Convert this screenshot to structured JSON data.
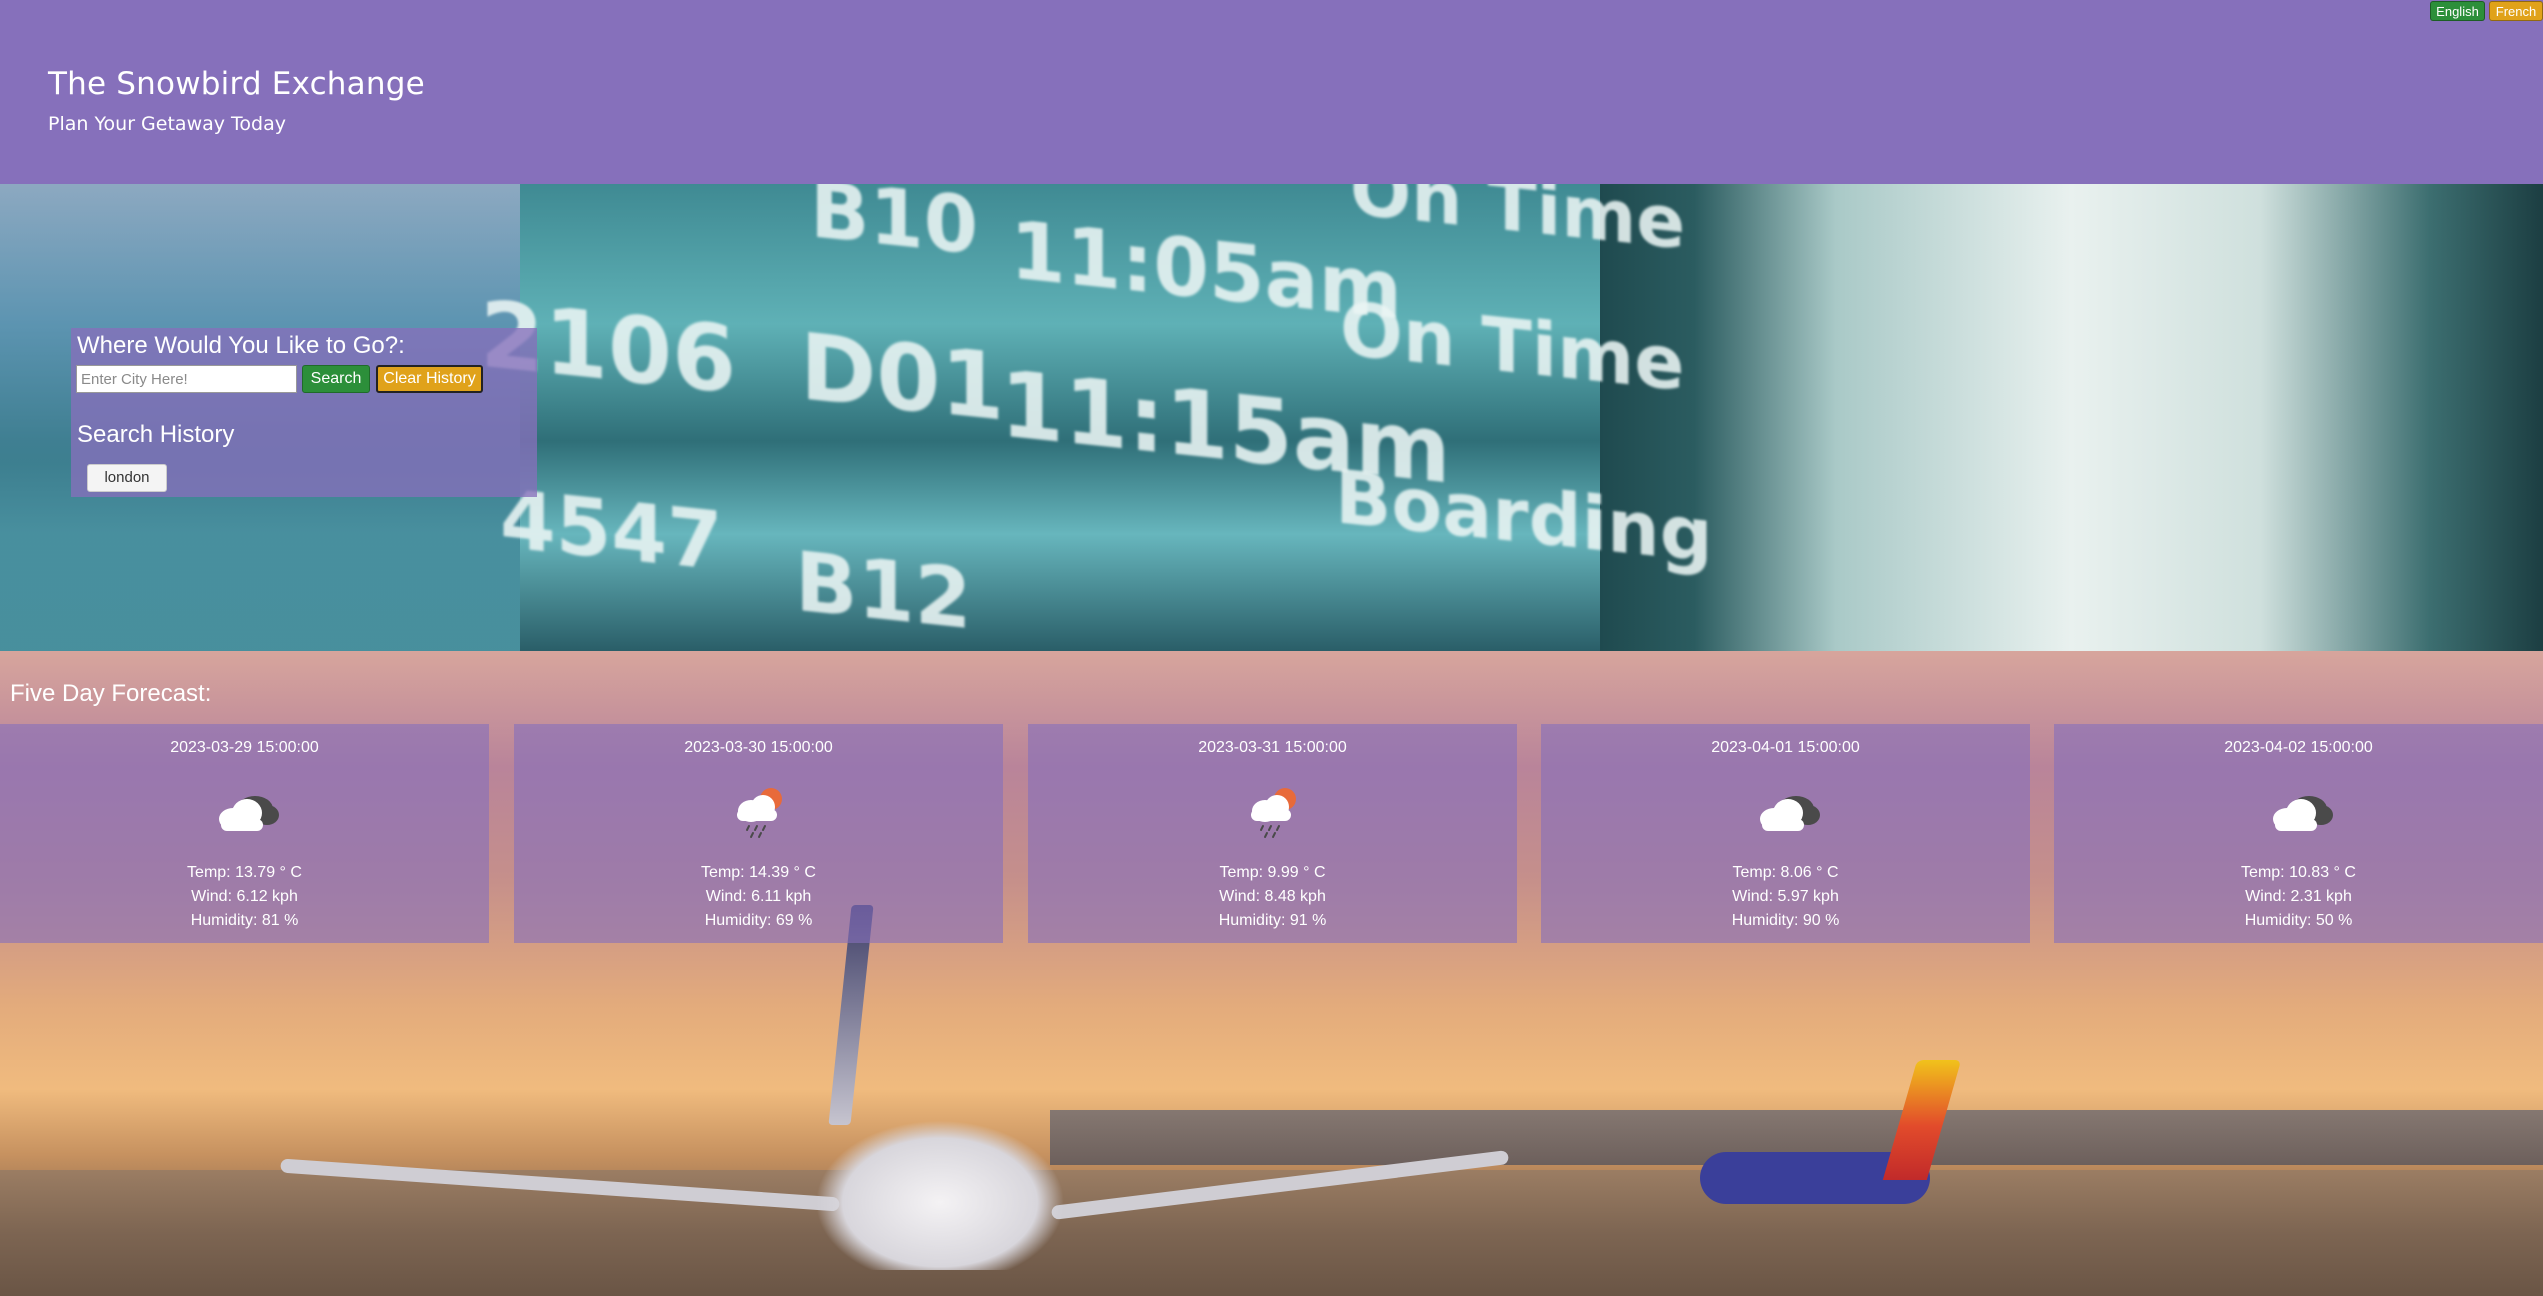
{
  "header": {
    "title": "The Snowbird Exchange",
    "subtitle": "Plan Your Getaway Today",
    "lang_english": "English",
    "lang_french": "French"
  },
  "hero_board": {
    "texts": [
      "B10",
      "11:05am",
      "On Time",
      "2106",
      "D01",
      "11:15am",
      "On Time",
      "4547",
      "B12",
      "Boarding"
    ]
  },
  "search": {
    "heading": "Where Would You Like to Go?:",
    "input_placeholder": "Enter City Here!",
    "input_value": "",
    "search_label": "Search",
    "clear_label": "Clear History",
    "history_heading": "Search History",
    "history_items": [
      "london"
    ]
  },
  "forecast": {
    "title": "Five Day Forecast:",
    "days": [
      {
        "date": "2023-03-29 15:00:00",
        "icon": "cloud-dark-icon",
        "temp": "Temp: 13.79 ° C",
        "wind": "Wind: 6.12 kph",
        "humidity": "Humidity: 81 %"
      },
      {
        "date": "2023-03-30 15:00:00",
        "icon": "sun-rain-cloud-icon",
        "temp": "Temp: 14.39 ° C",
        "wind": "Wind: 6.11 kph",
        "humidity": "Humidity: 69 %"
      },
      {
        "date": "2023-03-31 15:00:00",
        "icon": "sun-rain-cloud-icon",
        "temp": "Temp: 9.99 ° C",
        "wind": "Wind: 8.48 kph",
        "humidity": "Humidity: 91 %"
      },
      {
        "date": "2023-04-01 15:00:00",
        "icon": "cloud-dark-icon",
        "temp": "Temp: 8.06 ° C",
        "wind": "Wind: 5.97 kph",
        "humidity": "Humidity: 90 %"
      },
      {
        "date": "2023-04-02 15:00:00",
        "icon": "cloud-dark-icon",
        "temp": "Temp: 10.83 ° C",
        "wind": "Wind: 2.31 kph",
        "humidity": "Humidity: 50 %"
      }
    ]
  },
  "colors": {
    "header_bg": "#8670bb",
    "search_green": "#2c8f3a",
    "clear_gold": "#e0a21a"
  }
}
